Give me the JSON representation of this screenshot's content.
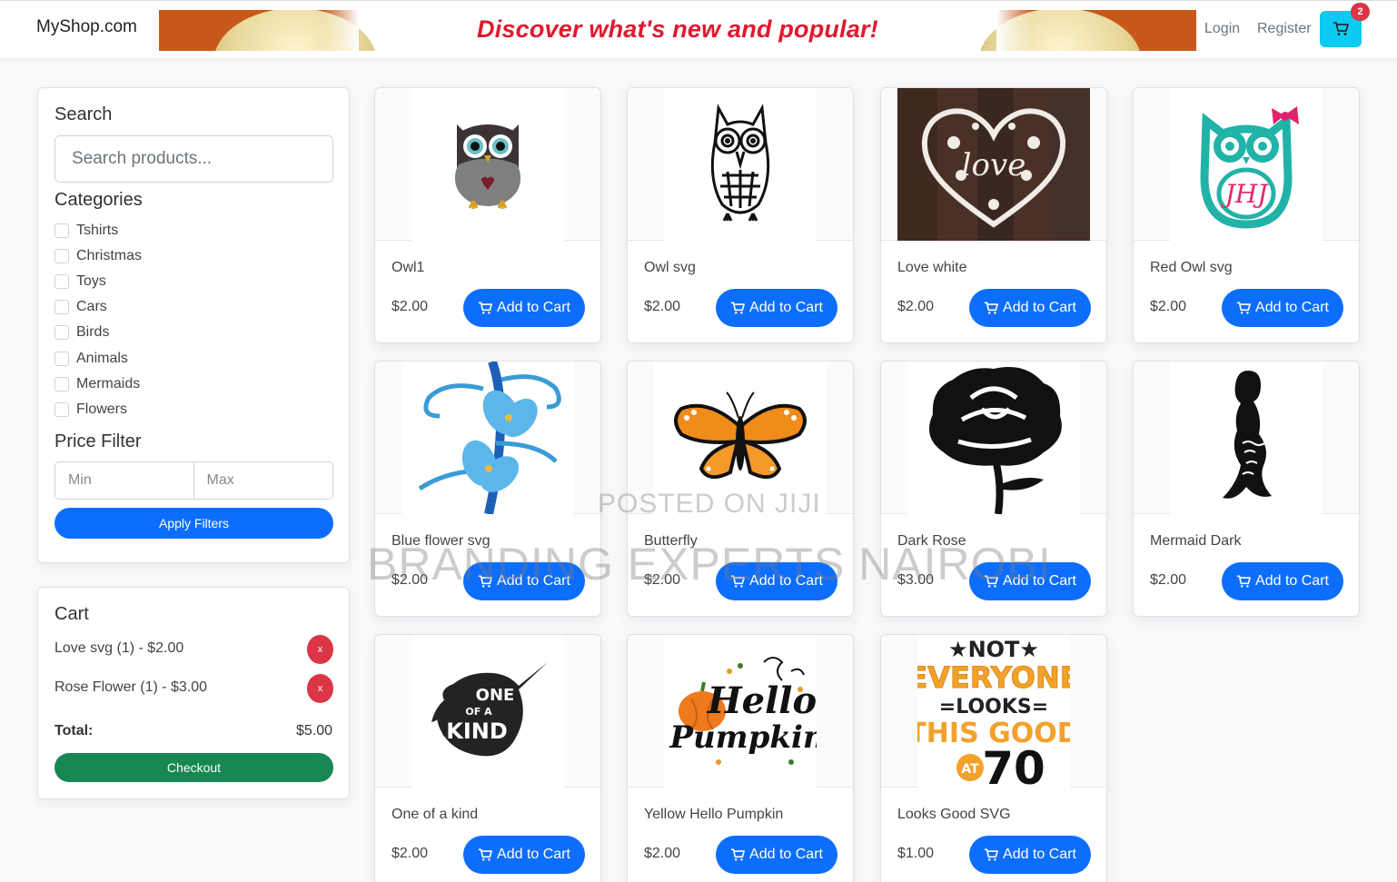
{
  "header": {
    "brand": "MyShop.com",
    "banner_text": "Discover what's new and popular!",
    "login": "Login",
    "register": "Register",
    "cart_count": "2",
    "cart_icon": "cart-icon"
  },
  "filters": {
    "search_title": "Search",
    "search_placeholder": "Search products...",
    "categories_title": "Categories",
    "categories": [
      "Tshirts",
      "Christmas",
      "Toys",
      "Cars",
      "Birds",
      "Animals",
      "Mermaids",
      "Flowers"
    ],
    "price_title": "Price Filter",
    "min_placeholder": "Min",
    "max_placeholder": "Max",
    "apply_label": "Apply Filters"
  },
  "cart": {
    "title": "Cart",
    "items": [
      {
        "label": "Love svg (1) - $2.00",
        "remove": "x"
      },
      {
        "label": "Rose Flower (1) - $3.00",
        "remove": "x"
      }
    ],
    "total_label": "Total:",
    "total_value": "$5.00",
    "checkout_label": "Checkout"
  },
  "products": [
    {
      "name": "Owl1",
      "price": "$2.00",
      "image": "owl-image"
    },
    {
      "name": "Owl svg",
      "price": "$2.00",
      "image": "owl-lineart-image"
    },
    {
      "name": "Love white",
      "price": "$2.00",
      "image": "love-heart-image"
    },
    {
      "name": "Red Owl svg",
      "price": "$2.00",
      "image": "monogram-owl-image"
    },
    {
      "name": "Blue flower svg",
      "price": "$2.00",
      "image": "blue-flower-image"
    },
    {
      "name": "Butterfly",
      "price": "$2.00",
      "image": "butterfly-image"
    },
    {
      "name": "Dark Rose",
      "price": "$3.00",
      "image": "rose-image"
    },
    {
      "name": "Mermaid Dark",
      "price": "$2.00",
      "image": "mermaid-image"
    },
    {
      "name": "One of a kind",
      "price": "$2.00",
      "image": "unicorn-image"
    },
    {
      "name": "Yellow Hello Pumpkin",
      "price": "$2.00",
      "image": "pumpkin-image"
    },
    {
      "name": "Looks Good SVG",
      "price": "$1.00",
      "image": "looks-good-image"
    }
  ],
  "add_to_cart_label": "Add to Cart",
  "image_text": {
    "love": "love",
    "monogram": "JHJ",
    "unicorn_lines": [
      "ONE",
      "OF A",
      "KIND"
    ],
    "pumpkin_lines": [
      "Hello",
      "Pumpkin"
    ],
    "looks_lines": [
      "★NOT★",
      "EVERYONE",
      "=LOOKS=",
      "THIS GOOD",
      "AT",
      "70"
    ]
  },
  "watermark": {
    "line1": "POSTED ON JIJI",
    "line2": "BRANDING EXPERTS NAIROBI"
  },
  "colors": {
    "primary": "#0d6efd",
    "success": "#198754",
    "danger": "#dc3545",
    "info": "#0dcaf0",
    "banner_red": "#e0192f"
  }
}
